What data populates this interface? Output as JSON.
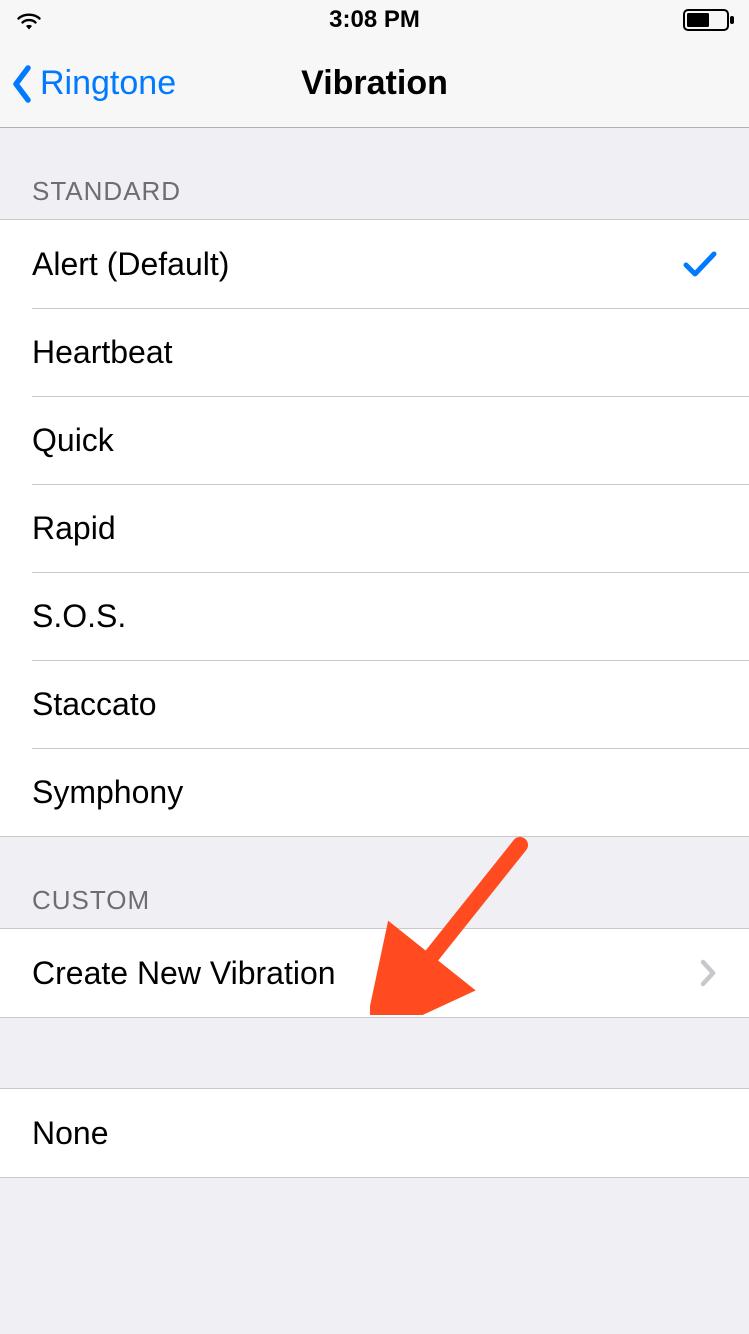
{
  "status": {
    "time": "3:08 PM"
  },
  "nav": {
    "back_label": "Ringtone",
    "title": "Vibration"
  },
  "sections": {
    "standard": {
      "header": "STANDARD",
      "items": [
        {
          "label": "Alert (Default)",
          "selected": true
        },
        {
          "label": "Heartbeat",
          "selected": false
        },
        {
          "label": "Quick",
          "selected": false
        },
        {
          "label": "Rapid",
          "selected": false
        },
        {
          "label": "S.O.S.",
          "selected": false
        },
        {
          "label": "Staccato",
          "selected": false
        },
        {
          "label": "Symphony",
          "selected": false
        }
      ]
    },
    "custom": {
      "header": "CUSTOM",
      "items": [
        {
          "label": "Create New Vibration",
          "disclosure": true
        }
      ]
    },
    "none": {
      "items": [
        {
          "label": "None"
        }
      ]
    }
  },
  "colors": {
    "tint": "#007aff",
    "annotation_arrow": "#ff4b1f"
  }
}
